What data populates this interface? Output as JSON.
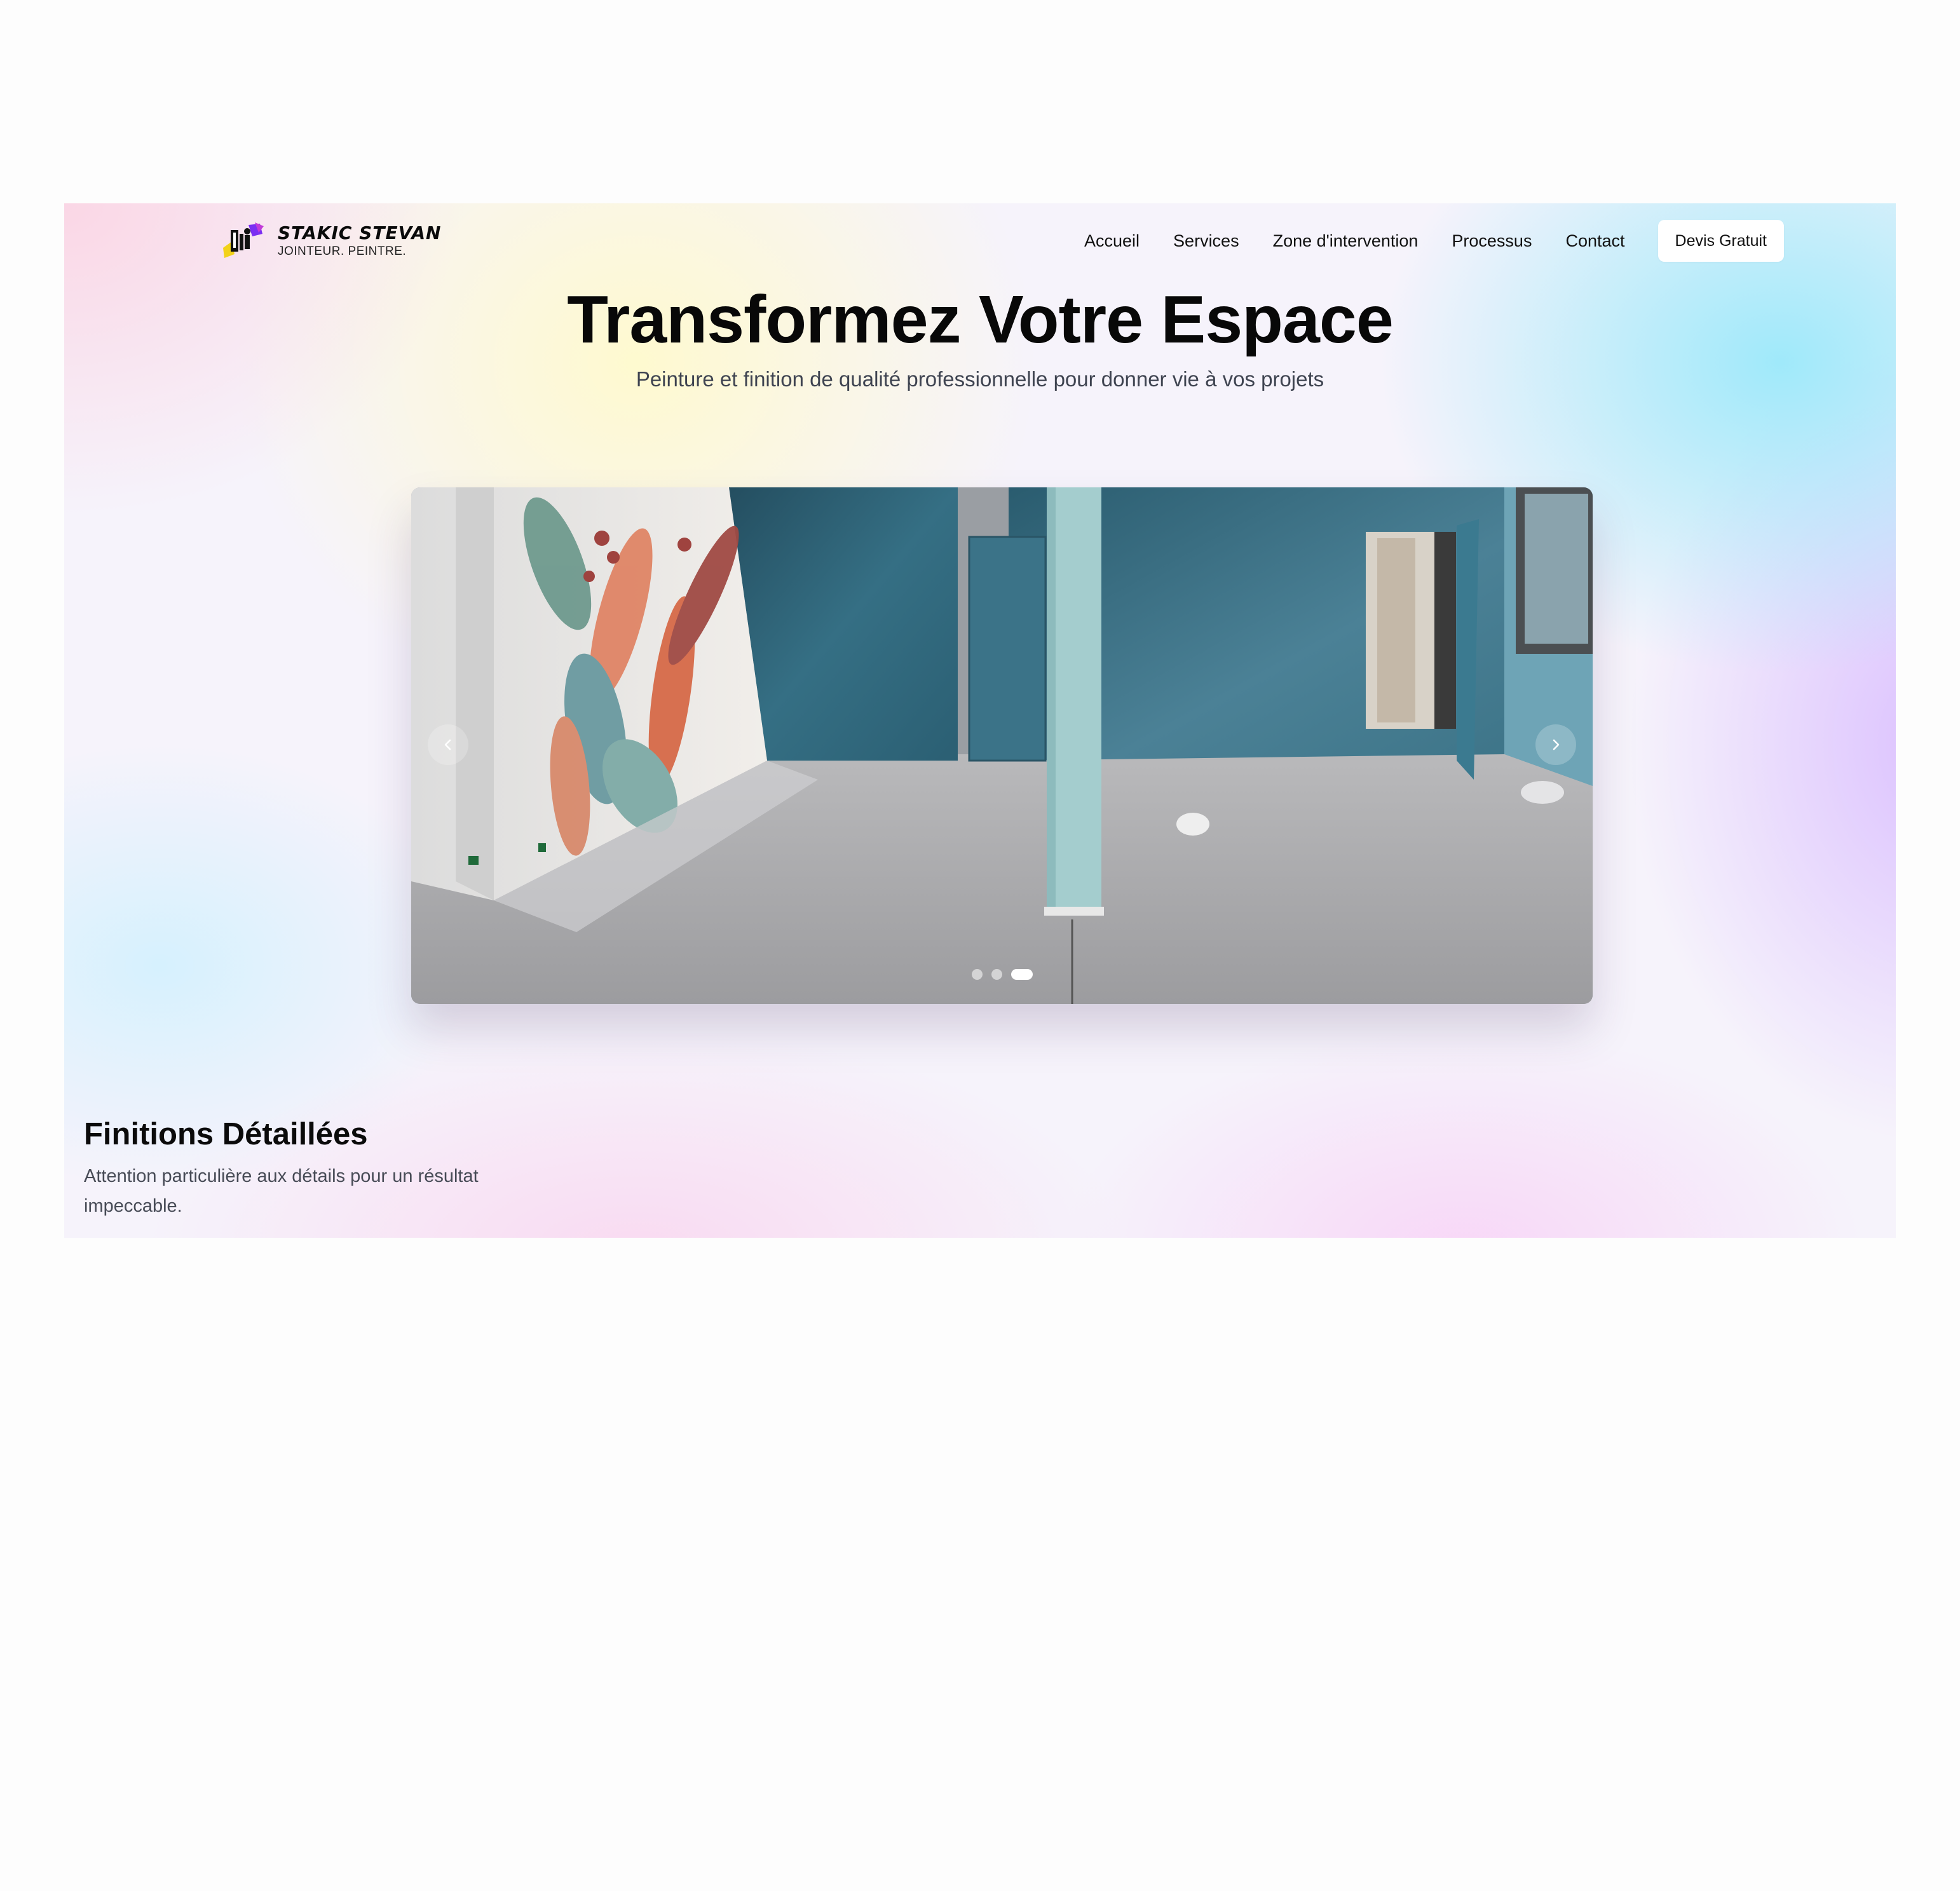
{
  "header": {
    "brand": "STAKIC STEVAN",
    "tagline": "JOINTEUR. PEINTRE.",
    "nav": [
      {
        "label": "Accueil"
      },
      {
        "label": "Services"
      },
      {
        "label": "Zone d'intervention"
      },
      {
        "label": "Processus"
      },
      {
        "label": "Contact"
      }
    ],
    "cta_label": "Devis Gratuit"
  },
  "hero": {
    "title": "Transformez Votre Espace",
    "subtitle": "Peinture et finition de qualité professionnelle pour donner vie à vos projets"
  },
  "carousel": {
    "slide_count": 3,
    "active_index": 3,
    "prev_icon": "chevron-left-icon",
    "next_icon": "chevron-right-icon"
  },
  "feature": {
    "title": "Finitions Détaillées",
    "description": "Attention particulière aux détails pour un résultat impeccable."
  },
  "colors": {
    "text_dark": "#080808",
    "text_muted": "#3f4451",
    "wall_teal": "#2f6579",
    "column_teal": "#a3cccc",
    "cta_background": "#ffffff"
  }
}
